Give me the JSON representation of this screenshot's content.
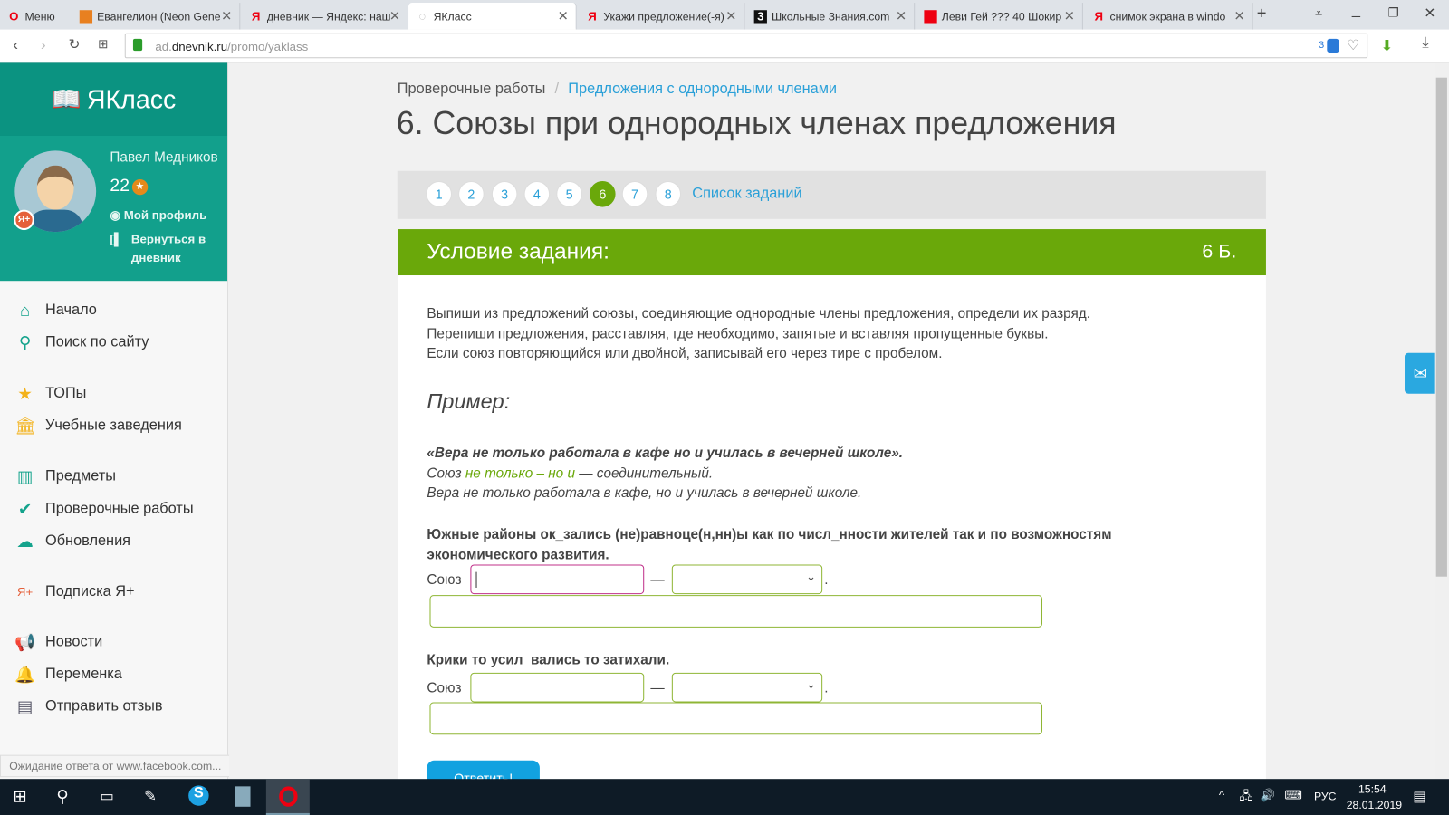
{
  "browser": {
    "menu": "Меню",
    "tabs": [
      "Евангелион (Neon Gene",
      "дневник — Яндекс: наш",
      "ЯКласс",
      "Укажи предложение(-я)",
      "Школьные Знания.com",
      "Леви Гей ??? 40 Шокир",
      "снимок экрана в windo"
    ],
    "url_host": "ad.",
    "url_domain": "dnevnik.ru",
    "url_path": "/promo/yaklass",
    "badge_count": "3",
    "status": "Ожидание ответа от www.facebook.com..."
  },
  "sidebar": {
    "logo": "ЯКласс",
    "user": "Павел Медников",
    "points": "22",
    "my_profile": "Мой профиль",
    "back": "Вернуться в дневник",
    "items": [
      "Начало",
      "Поиск по сайту",
      "ТОПы",
      "Учебные заведения",
      "Предметы",
      "Проверочные работы",
      "Обновления",
      "Подписка Я+",
      "Новости",
      "Переменка",
      "Отправить отзыв"
    ]
  },
  "breadcrumb": {
    "parent": "Проверочные работы",
    "current": "Предложения с однородными членами"
  },
  "title": "6. Союзы при однородных членах предложения",
  "pagination": {
    "pages": [
      "1",
      "2",
      "3",
      "4",
      "5",
      "6",
      "7",
      "8"
    ],
    "current": "6",
    "list_link": "Список заданий"
  },
  "task": {
    "header": "Условие задания:",
    "score": "6 Б.",
    "instructions": [
      "Выпиши из предложений союзы, соединяющие однородные члены предложения, определи их разряд.",
      "Перепиши предложения, расставляя, где необходимо, запятые и вставляя пропущенные буквы.",
      "Если союз повторяющийся или двойной, записывай его через тире с пробелом."
    ],
    "example_title": "Пример:",
    "example_sentence": "«Вера не только работала в кафе но и училась в вечерней школе».",
    "example_prefix": "Союз ",
    "example_union": "не только – но и",
    "example_suffix": " — соединительный.",
    "example_answer": "Вера не только работала в кафе, но и училась в вечерней школе.",
    "questions": [
      {
        "text": "Южные районы ок_зались (не)равноце(н,нн)ы как по числ_нности жителей так и по возможностям экономического развития.",
        "label": "Союз",
        "dash": "—",
        "dot": "."
      },
      {
        "text": "Крики то усил_вались то затихали.",
        "label": "Союз",
        "dash": "—",
        "dot": "."
      }
    ],
    "submit": "Ответить!"
  },
  "taskbar": {
    "lang": "РУС",
    "time": "15:54",
    "date": "28.01.2019"
  },
  "colors": {
    "green": "#6aa80a",
    "teal": "#12a08c",
    "link": "#2aa0d8"
  }
}
